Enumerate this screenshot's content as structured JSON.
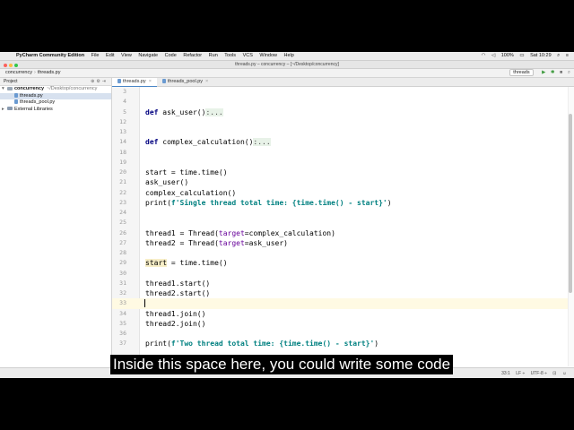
{
  "menubar": {
    "app_name": "PyCharm Community Edition",
    "menus": [
      "File",
      "Edit",
      "View",
      "Navigate",
      "Code",
      "Refactor",
      "Run",
      "Tools",
      "VCS",
      "Window",
      "Help"
    ],
    "battery": "100%",
    "clock": "Sat 10:29"
  },
  "window": {
    "title": "threads.py – concurrency – [~/Desktop/concurrency]"
  },
  "navbar": {
    "project": "concurrency",
    "file": "threads.py",
    "run_config": "threads"
  },
  "project_panel": {
    "header": "Project",
    "root_name": "concurrency",
    "root_path": "~/Desktop/concurrency",
    "files": [
      "threads.py",
      "threads_pool.py"
    ],
    "external": "External Libraries"
  },
  "tabs": [
    {
      "label": "threads.py",
      "active": true
    },
    {
      "label": "threads_pool.py",
      "active": false
    }
  ],
  "editor": {
    "current_line": "33",
    "lines": [
      {
        "n": "3",
        "code": ""
      },
      {
        "n": "4",
        "code": ""
      },
      {
        "n": "5",
        "code": "def ask_user():..."
      },
      {
        "n": "12",
        "code": ""
      },
      {
        "n": "13",
        "code": ""
      },
      {
        "n": "14",
        "code": "def complex_calculation():..."
      },
      {
        "n": "18",
        "code": ""
      },
      {
        "n": "19",
        "code": ""
      },
      {
        "n": "20",
        "code": "start = time.time()"
      },
      {
        "n": "21",
        "code": "ask_user()"
      },
      {
        "n": "22",
        "code": "complex_calculation()"
      },
      {
        "n": "23",
        "code": "print(f'Single thread total time: {time.time() - start}')"
      },
      {
        "n": "24",
        "code": ""
      },
      {
        "n": "25",
        "code": ""
      },
      {
        "n": "26",
        "code": "thread1 = Thread(target=complex_calculation)"
      },
      {
        "n": "27",
        "code": "thread2 = Thread(target=ask_user)"
      },
      {
        "n": "28",
        "code": ""
      },
      {
        "n": "29",
        "code": "start = time.time()"
      },
      {
        "n": "30",
        "code": ""
      },
      {
        "n": "31",
        "code": "thread1.start()"
      },
      {
        "n": "32",
        "code": "thread2.start()"
      },
      {
        "n": "33",
        "code": ""
      },
      {
        "n": "34",
        "code": "thread1.join()"
      },
      {
        "n": "35",
        "code": "thread2.join()"
      },
      {
        "n": "36",
        "code": ""
      },
      {
        "n": "37",
        "code": "print(f'Two thread total time: {time.time() - start}')"
      }
    ]
  },
  "statusbar": {
    "position": "33:1",
    "line_sep": "LF ÷",
    "encoding": "UTF-8 ÷"
  },
  "subtitle": "Inside this space here, you could write some code",
  "colors": {
    "keyword": "#000080",
    "string": "#008080",
    "kwarg": "#660099",
    "current_line": "#fffae3"
  }
}
